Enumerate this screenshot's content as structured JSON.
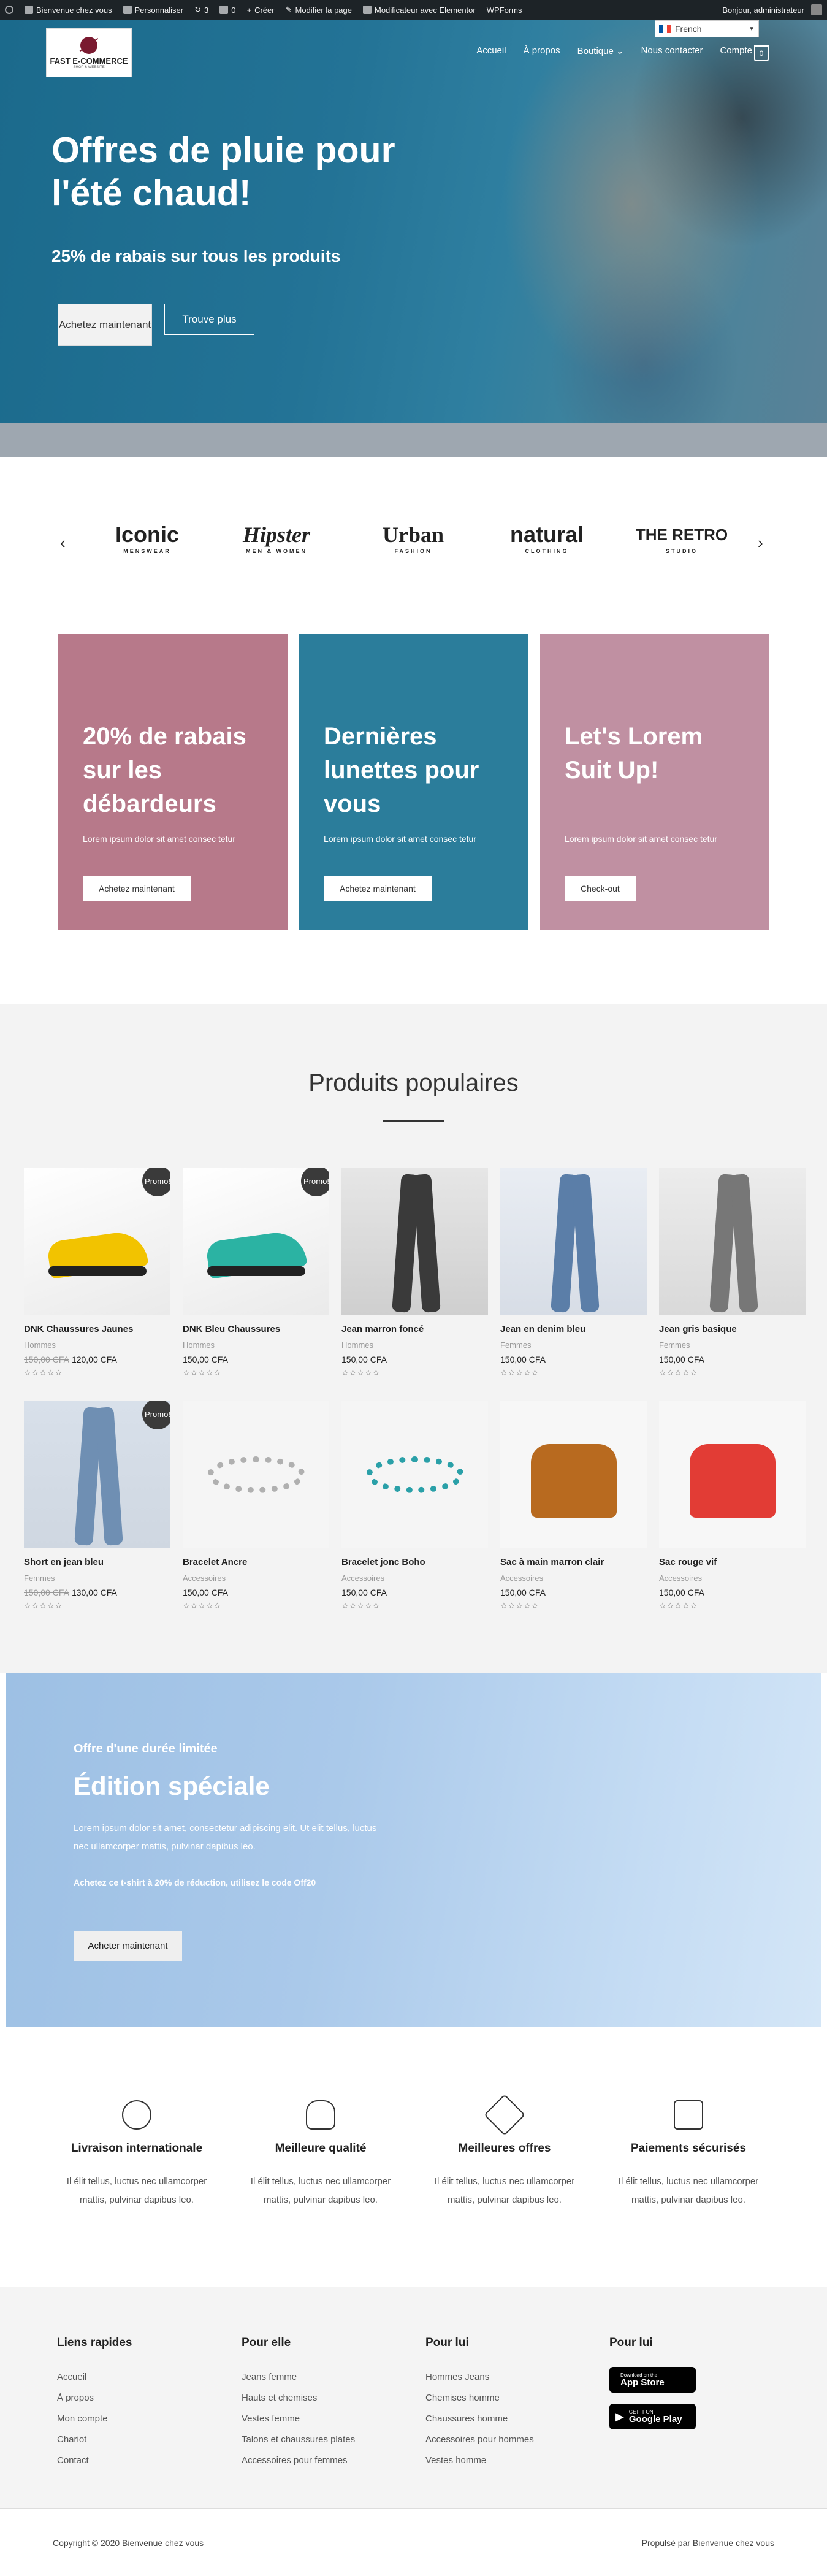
{
  "admin_bar": {
    "site": "Bienvenue chez vous",
    "customize": "Personnaliser",
    "updates": "3",
    "comments": "0",
    "new": "Créer",
    "edit": "Modifier la page",
    "elementor": "Modificateur avec Elementor",
    "wpforms": "WPForms",
    "greeting": "Bonjour, administrateur"
  },
  "header": {
    "logo_title": "FAST E-COMMERCE",
    "logo_sub": "SHOP & WEBSITE",
    "nav": [
      "Accueil",
      "À propos",
      "Boutique",
      "Nous contacter",
      "Compte"
    ],
    "cart_count": "0",
    "language": "French"
  },
  "hero": {
    "title": "Offres de pluie pour l'été chaud!",
    "subtitle": "25% de rabais sur tous les produits",
    "buy_button": "Achetez maintenant",
    "more_button": "Trouve plus"
  },
  "brands": {
    "items": [
      {
        "name": "Iconic",
        "tag": "MENSWEAR"
      },
      {
        "name": "Hipster",
        "tag": "MEN & WOMEN"
      },
      {
        "name": "Urban",
        "tag": "FASHION"
      },
      {
        "name": "natural",
        "tag": "CLOTHING"
      },
      {
        "name": "THE RETRO",
        "tag": "STUDIO"
      }
    ]
  },
  "banners": [
    {
      "title": "20% de rabais sur les débardeurs",
      "text": "Lorem ipsum dolor sit amet consec tetur",
      "button": "Achetez maintenant",
      "color": "#b7798a"
    },
    {
      "title": "Dernières lunettes pour vous",
      "text": "Lorem ipsum dolor sit amet consec tetur",
      "button": "Achetez maintenant",
      "color": "#2b7d9b"
    },
    {
      "title": "Let's Lorem Suit Up!",
      "text": "Lorem ipsum dolor sit amet consec tetur",
      "button": "Check-out",
      "color": "#c090a2"
    }
  ],
  "popular": {
    "title": "Produits populaires",
    "promo_label": "Promo!",
    "stars": "☆☆☆☆☆",
    "products": [
      {
        "name": "DNK Chaussures Jaunes",
        "category": "Hommes",
        "old_price": "150,00 CFA",
        "price": "120,00 CFA",
        "promo": true
      },
      {
        "name": "DNK Bleu Chaussures",
        "category": "Hommes",
        "old_price": "",
        "price": "150,00 CFA",
        "promo": true
      },
      {
        "name": "Jean marron foncé",
        "category": "Hommes",
        "old_price": "",
        "price": "150,00 CFA",
        "promo": false
      },
      {
        "name": "Jean en denim bleu",
        "category": "Femmes",
        "old_price": "",
        "price": "150,00 CFA",
        "promo": false
      },
      {
        "name": "Jean gris basique",
        "category": "Femmes",
        "old_price": "",
        "price": "150,00 CFA",
        "promo": false
      },
      {
        "name": "Short en jean bleu",
        "category": "Femmes",
        "old_price": "150,00 CFA",
        "price": "130,00 CFA",
        "promo": true
      },
      {
        "name": "Bracelet Ancre",
        "category": "Accessoires",
        "old_price": "",
        "price": "150,00 CFA",
        "promo": false
      },
      {
        "name": "Bracelet jonc Boho",
        "category": "Accessoires",
        "old_price": "",
        "price": "150,00 CFA",
        "promo": false
      },
      {
        "name": "Sac à main marron clair",
        "category": "Accessoires",
        "old_price": "",
        "price": "150,00 CFA",
        "promo": false
      },
      {
        "name": "Sac rouge vif",
        "category": "Accessoires",
        "old_price": "",
        "price": "150,00 CFA",
        "promo": false
      }
    ]
  },
  "special": {
    "kicker": "Offre d'une durée limitée",
    "title": "Édition spéciale",
    "text": "Lorem ipsum dolor sit amet, consectetur adipiscing elit. Ut elit tellus, luctus nec ullamcorper mattis, pulvinar dapibus leo.",
    "code_text": "Achetez ce t-shirt à 20% de réduction, utilisez le code Off20",
    "button": "Acheter maintenant"
  },
  "features": [
    {
      "title": "Livraison internationale",
      "text": "Il élit tellus, luctus nec ullamcorper mattis, pulvinar dapibus leo.",
      "icon": "globe-icon"
    },
    {
      "title": "Meilleure qualité",
      "text": "Il élit tellus, luctus nec ullamcorper mattis, pulvinar dapibus leo.",
      "icon": "mannequin-icon"
    },
    {
      "title": "Meilleures offres",
      "text": "Il élit tellus, luctus nec ullamcorper mattis, pulvinar dapibus leo.",
      "icon": "tag-icon"
    },
    {
      "title": "Paiements sécurisés",
      "text": "Il élit tellus, luctus nec ullamcorper mattis, pulvinar dapibus leo.",
      "icon": "lock-icon"
    }
  ],
  "footer": {
    "quick": {
      "title": "Liens rapides",
      "links": [
        "Accueil",
        "À propos",
        "Mon compte",
        "Chariot",
        "Contact"
      ]
    },
    "her": {
      "title": "Pour elle",
      "links": [
        "Jeans femme",
        "Hauts et chemises",
        "Vestes femme",
        "Talons et chaussures plates",
        "Accessoires pour femmes"
      ]
    },
    "him": {
      "title": "Pour lui",
      "links": [
        "Hommes Jeans",
        "Chemises homme",
        "Chaussures homme",
        "Accessoires pour hommes",
        "Vestes homme"
      ]
    },
    "apps": {
      "title": "Pour lui",
      "appstore_small": "Download on the",
      "appstore": "App Store",
      "play_small": "GET IT ON",
      "play": "Google Play"
    }
  },
  "bottom": {
    "copyright": "Copyright © 2020 Bienvenue chez vous",
    "powered": "Propulsé par Bienvenue chez vous"
  }
}
